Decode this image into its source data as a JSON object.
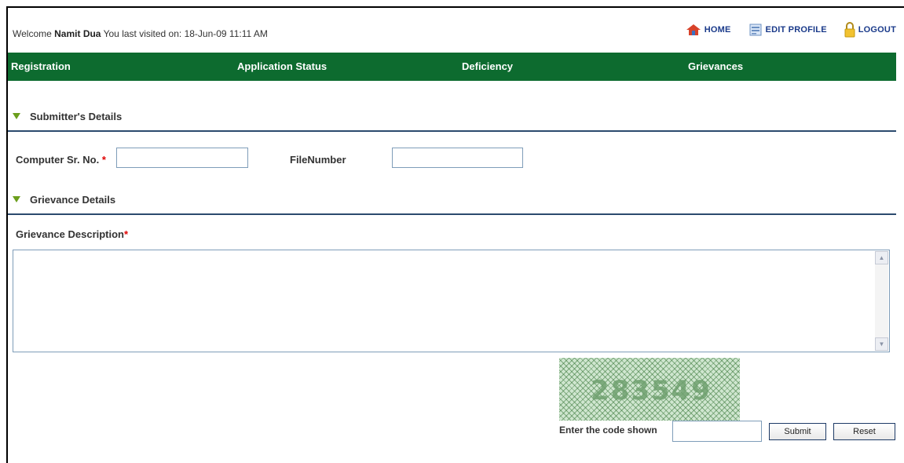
{
  "header": {
    "welcome_prefix": "Welcome",
    "user_name": "Namit Dua",
    "last_visited": "You last visited on: 18-Jun-09 11:11 AM",
    "links": [
      {
        "label": "HOME",
        "icon": "home-icon"
      },
      {
        "label": "EDIT PROFILE",
        "icon": "edit-profile-icon"
      },
      {
        "label": "LOGOUT",
        "icon": "lock-icon"
      }
    ]
  },
  "nav": {
    "items": [
      "Registration",
      "Application Status",
      "Deficiency",
      "Grievances"
    ],
    "background": "#0d6b2f"
  },
  "submitter": {
    "title": "Submitter's Details",
    "computer_sr_label": "Computer Sr. No.",
    "computer_sr_value": "",
    "file_number_label": "FileNumber",
    "file_number_value": ""
  },
  "grievance": {
    "title": "Grievance Details",
    "description_label": "Grievance Description",
    "description_value": ""
  },
  "required_mark": "*",
  "captcha": {
    "code": "283549",
    "enter_label": "Enter the code shown",
    "input_value": "",
    "submit_label": "Submit",
    "reset_label": "Reset"
  }
}
